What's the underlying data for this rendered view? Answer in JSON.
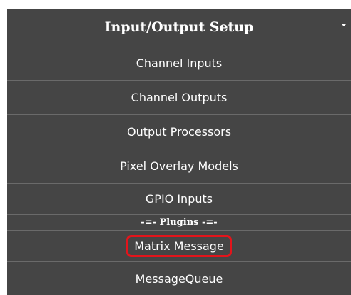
{
  "menu": {
    "header": "Input/Output Setup",
    "items": [
      {
        "label": "Channel Inputs"
      },
      {
        "label": "Channel Outputs"
      },
      {
        "label": "Output Processors"
      },
      {
        "label": "Pixel Overlay Models"
      },
      {
        "label": "GPIO Inputs"
      }
    ],
    "plugins_divider": "-=- Plugins -=-",
    "plugins": [
      {
        "label": "Matrix Message",
        "highlighted": true
      },
      {
        "label": "MessageQueue"
      }
    ]
  },
  "colors": {
    "menu_bg": "#454545",
    "text": "#ffffff",
    "highlight_border": "#e3141b"
  }
}
